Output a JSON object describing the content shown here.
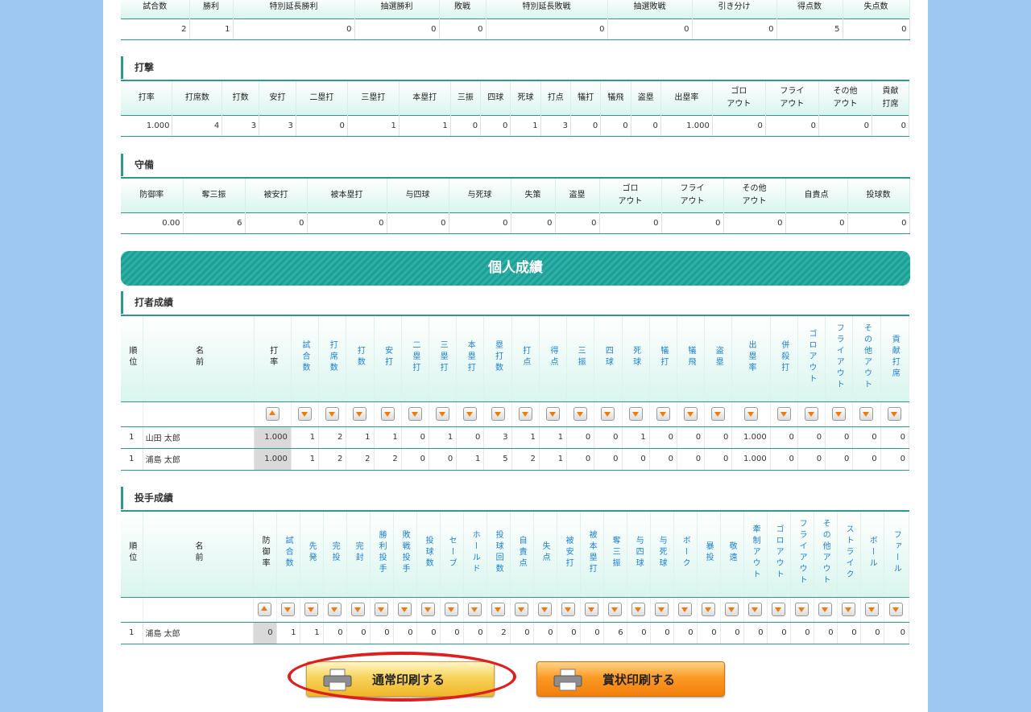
{
  "record_summary": {
    "headers": [
      "試合数",
      "勝利",
      "特別延長勝利",
      "抽選勝利",
      "敗戦",
      "特別延長敗戦",
      "抽選敗戦",
      "引き分け",
      "得点数",
      "失点数"
    ],
    "values": [
      "2",
      "1",
      "0",
      "0",
      "0",
      "0",
      "0",
      "0",
      "5",
      "0"
    ]
  },
  "batting": {
    "title": "打撃",
    "headers": [
      "打率",
      "打席数",
      "打数",
      "安打",
      "二塁打",
      "三塁打",
      "本塁打",
      "三振",
      "四球",
      "死球",
      "打点",
      "犠打",
      "犠飛",
      "盗塁",
      "出塁率",
      "ゴロ\nアウト",
      "フライ\nアウト",
      "その他\nアウト",
      "貢献\n打席"
    ],
    "values": [
      "1.000",
      "4",
      "3",
      "3",
      "0",
      "1",
      "1",
      "0",
      "0",
      "1",
      "3",
      "0",
      "0",
      "0",
      "1.000",
      "0",
      "0",
      "0",
      "0"
    ]
  },
  "fielding": {
    "title": "守備",
    "headers": [
      "防御率",
      "奪三振",
      "被安打",
      "被本塁打",
      "与四球",
      "与死球",
      "失策",
      "盗塁",
      "ゴロ\nアウト",
      "フライ\nアウト",
      "その他\nアウト",
      "自責点",
      "投球数"
    ],
    "values": [
      "0.00",
      "6",
      "0",
      "0",
      "0",
      "0",
      "0",
      "0",
      "0",
      "0",
      "0",
      "0",
      "0"
    ]
  },
  "individual_banner": "個人成績",
  "batters": {
    "title": "打者成績",
    "col_rank": "順位",
    "col_name": "名前",
    "stat_headers": [
      "打率",
      "試合数",
      "打席数",
      "打数",
      "安打",
      "二塁打",
      "三塁打",
      "本塁打",
      "塁打数",
      "打点",
      "得点",
      "三振",
      "四球",
      "死球",
      "犠打",
      "犠飛",
      "盗塁",
      "出塁率",
      "併殺打",
      "ゴロアウト",
      "フライアウト",
      "その他アウト",
      "貢献打席"
    ],
    "rows": [
      {
        "rank": "1",
        "name": "山田 太郎",
        "stats": [
          "1.000",
          "1",
          "2",
          "1",
          "1",
          "0",
          "1",
          "0",
          "3",
          "1",
          "1",
          "0",
          "0",
          "1",
          "0",
          "0",
          "0",
          "1.000",
          "0",
          "0",
          "0",
          "0",
          "0"
        ]
      },
      {
        "rank": "1",
        "name": "浦島 太郎",
        "stats": [
          "1.000",
          "1",
          "2",
          "2",
          "2",
          "0",
          "0",
          "1",
          "5",
          "2",
          "1",
          "0",
          "0",
          "0",
          "0",
          "0",
          "0",
          "1.000",
          "0",
          "0",
          "0",
          "0",
          "0"
        ]
      }
    ]
  },
  "pitchers": {
    "title": "投手成績",
    "col_rank": "順位",
    "col_name": "名前",
    "stat_headers": [
      "防御率",
      "試合数",
      "先発",
      "完投",
      "完封",
      "勝利投手",
      "敗戦投手",
      "投球数",
      "セーブ",
      "ホールド",
      "投球回数",
      "自責点",
      "失点",
      "被安打",
      "被本塁打",
      "奪三振",
      "与四球",
      "与死球",
      "ボーク",
      "暴投",
      "敬遠",
      "牽制アウト",
      "ゴロアウト",
      "フライアウト",
      "その他アウト",
      "ストライク",
      "ボール",
      "ファール"
    ],
    "rows": [
      {
        "rank": "1",
        "name": "浦島 太郎",
        "stats": [
          "0",
          "1",
          "1",
          "0",
          "0",
          "0",
          "0",
          "0",
          "0",
          "0",
          "2",
          "0",
          "0",
          "0",
          "0",
          "6",
          "0",
          "0",
          "0",
          "0",
          "0",
          "0",
          "0",
          "0",
          "0",
          "0",
          "0",
          "0"
        ]
      }
    ]
  },
  "buttons": {
    "normal_print": "通常印刷する",
    "award_print": "賞状印刷する"
  },
  "colors": {
    "accent": "#2a9a8e",
    "sort_arrow": "#f07a10",
    "highlight_circle": "#e01e1e"
  }
}
